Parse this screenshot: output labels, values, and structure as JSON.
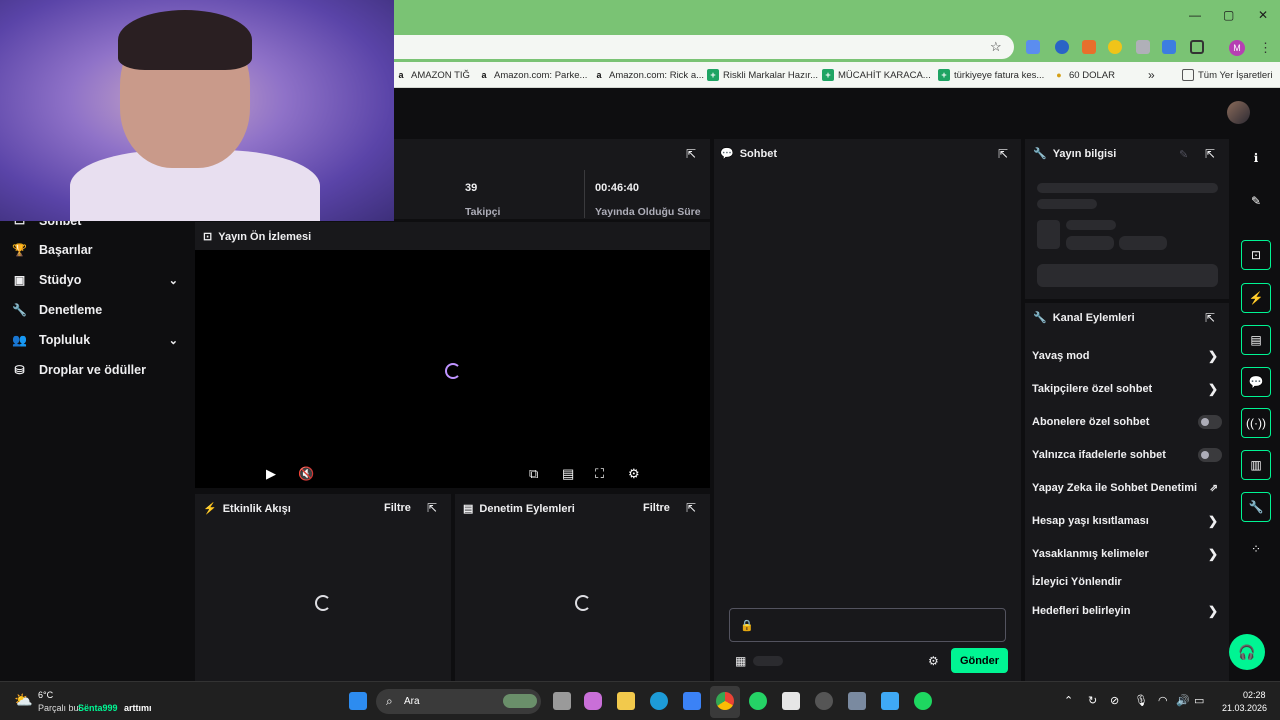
{
  "browser": {
    "window_controls": [
      "—",
      "▢",
      "✕"
    ],
    "bookmarks": [
      {
        "label": "AMAZON TIĞ",
        "icon": "a"
      },
      {
        "label": "Amazon.com: Parke...",
        "icon": "a"
      },
      {
        "label": "Amazon.com: Rick a...",
        "icon": "a"
      },
      {
        "label": "Riskli Markalar Hazır...",
        "icon": "+"
      },
      {
        "label": "MÜCAHİT KARACA...",
        "icon": "+"
      },
      {
        "label": "türkiyeye fatura kes...",
        "icon": "+"
      },
      {
        "label": "60 DOLAR",
        "icon": "●"
      }
    ],
    "bookmarks_more": "»",
    "all_bookmarks": "Tüm Yer İşaretleri",
    "profile_initial": "M"
  },
  "sidebar": {
    "items": [
      {
        "label": "Başarılar",
        "icon": "🏆"
      },
      {
        "label": "Stüdyo",
        "icon": "▣",
        "chevron": "⌄"
      },
      {
        "label": "Denetleme",
        "icon": "🔧"
      },
      {
        "label": "Topluluk",
        "icon": "👥",
        "chevron": "⌄"
      },
      {
        "label": "Droplar ve ödüller",
        "icon": "⛁"
      }
    ],
    "partial_item": "Sohbet"
  },
  "stats": {
    "followers_value": "39",
    "followers_label": "Takipçi",
    "uptime_value": "00:46:40",
    "uptime_label": "Yayında Olduğu Süre"
  },
  "preview": {
    "title": "Yayın Ön İzlemesi"
  },
  "activity_feed": {
    "title": "Etkinlik Akışı",
    "filter": "Filtre"
  },
  "mod_actions": {
    "title": "Denetim Eylemleri",
    "filter": "Filtre"
  },
  "chat": {
    "title": "Sohbet",
    "send_label": "Gönder"
  },
  "stream_info": {
    "title": "Yayın bilgisi"
  },
  "channel_actions": {
    "title": "Kanal Eylemleri",
    "items": [
      {
        "label": "Yavaş mod",
        "control": "arrow"
      },
      {
        "label": "Takipçilere özel sohbet",
        "control": "arrow"
      },
      {
        "label": "Abonelere özel sohbet",
        "control": "toggle"
      },
      {
        "label": "Yalnızca ifadelerle sohbet",
        "control": "toggle"
      },
      {
        "label": "Yapay Zeka ile Sohbet Denetimi",
        "control": "external"
      },
      {
        "label": "Hesap yaşı kısıtlaması",
        "control": "arrow"
      },
      {
        "label": "Yasaklanmış kelimeler",
        "control": "arrow"
      },
      {
        "label": "İzleyici Yönlendir",
        "control": "none"
      },
      {
        "label": "Hedefleri belirleyin",
        "control": "arrow"
      }
    ]
  },
  "taskbar": {
    "weather_temp": "6°C",
    "weather_text": "Parçalı bul",
    "notification_user": "Sënta999",
    "notification_text": "arttımı",
    "search_label": "Ara",
    "time": "02:28",
    "date": "21.03.2026"
  },
  "colors": {
    "accent": "#00f593",
    "purple": "#bf94ff",
    "chrome_green": "#7ac374",
    "panel": "#18181b",
    "background": "#0e0e10"
  }
}
